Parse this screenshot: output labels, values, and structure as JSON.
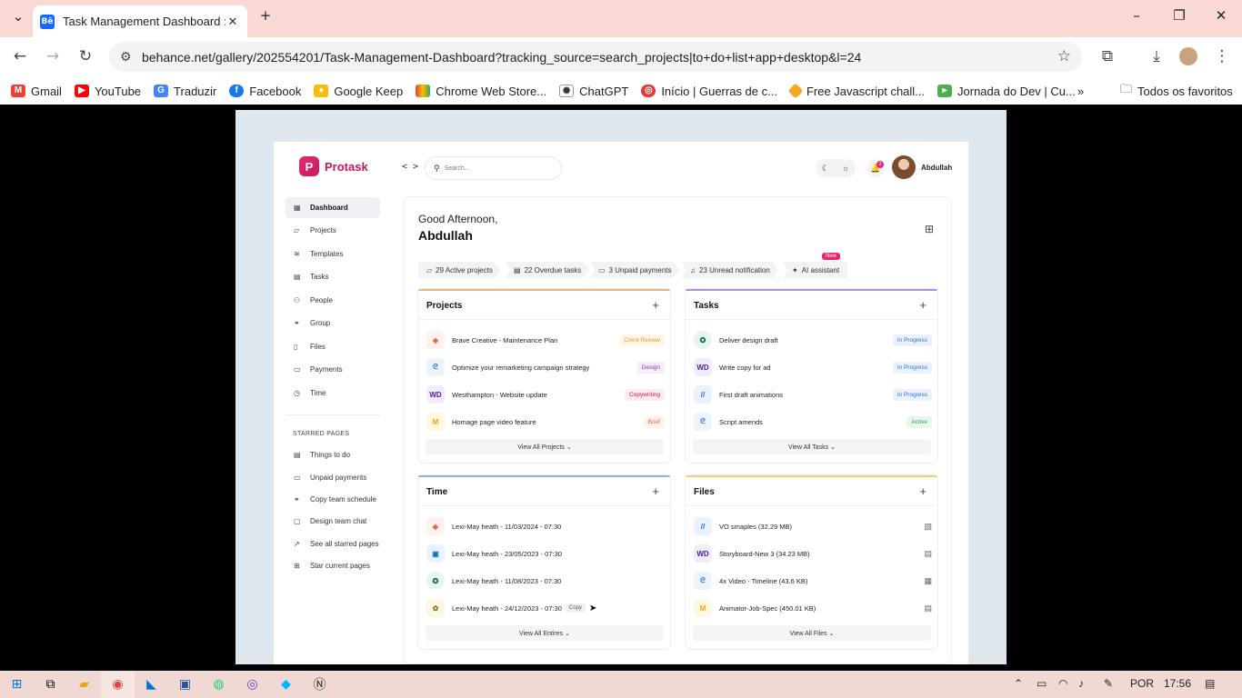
{
  "browser": {
    "tab_title": "Task Management Dashboard ::",
    "tab_favicon": "Bē",
    "url": "behance.net/gallery/202554201/Task-Management-Dashboard?tracking_source=search_projects|to+do+list+app+desktop&l=24",
    "bookmarks": [
      "Gmail",
      "YouTube",
      "Traduzir",
      "Facebook",
      "Google Keep",
      "Chrome Web Store...",
      "ChatGPT",
      "Início | Guerras de c...",
      "Free Javascript chall...",
      "Jornada do Dev | Cu..."
    ],
    "all_bookmarks": "Todos os favoritos"
  },
  "app": {
    "logo": "Protask",
    "search_placeholder": "Search...",
    "notification_count": "2",
    "user_name": "Abdullah",
    "sidebar": [
      "Dashboard",
      "Projects",
      "Templates",
      "Tasks",
      "People",
      "Group",
      "Files",
      "Payments",
      "Time"
    ],
    "starred_heading": "STARRED PAGES",
    "starred": [
      "Things to do",
      "Unpaid payments",
      "Copy team schedule",
      "Design team chat",
      "See all starred pages",
      "Star current pages"
    ],
    "greeting": "Good Afternoon,",
    "greeting_name": "Abdullah",
    "chips": [
      "29 Active projects",
      "22 Overdue tasks",
      "3 Unpaid payments",
      "23 Unread notification",
      "AI assistant"
    ],
    "new_badge": "New",
    "projects": {
      "title": "Projects",
      "rows": [
        {
          "name": "Brave Creative - Maintenance Plan",
          "tag": "Client Review"
        },
        {
          "name": "Optimize your remarketing campaign strategy",
          "tag": "Design"
        },
        {
          "name": "Westhampton - Website update",
          "tag": "Copywriting"
        },
        {
          "name": "Homage page video feature",
          "tag": "Brief"
        }
      ],
      "view_all": "View All Projects ⌄"
    },
    "tasks": {
      "title": "Tasks",
      "rows": [
        {
          "name": "Deliver design draft",
          "tag": "In Progress"
        },
        {
          "name": "Write copy for ad",
          "tag": "In Progress"
        },
        {
          "name": "First draft animations",
          "tag": "In Progress"
        },
        {
          "name": "Script amends",
          "tag": "Active"
        }
      ],
      "view_all": "View All Tasks ⌄"
    },
    "time": {
      "title": "Time",
      "rows": [
        "Lexi-May heath - 11/03/2024 - 07:30",
        "Lexi-May heath - 23/05/2023 - 07:30",
        "Lexi-May heath - 11/08/2023 - 07:30",
        "Lexi-May heath - 24/12/2023 - 07:30"
      ],
      "copy": "Copy",
      "view_all": "View All Entires ⌄"
    },
    "files": {
      "title": "Files",
      "rows": [
        "VO smaples (32.29 MB)",
        "Storyboard-New 3 (34.23 MB)",
        "4x Video - Timeline (43.6 KB)",
        "Animator-Job-Spec (450.01 KB)"
      ],
      "view_all": "View All Files ⌄"
    }
  },
  "taskbar": {
    "lang": "POR",
    "time": "17:56"
  }
}
